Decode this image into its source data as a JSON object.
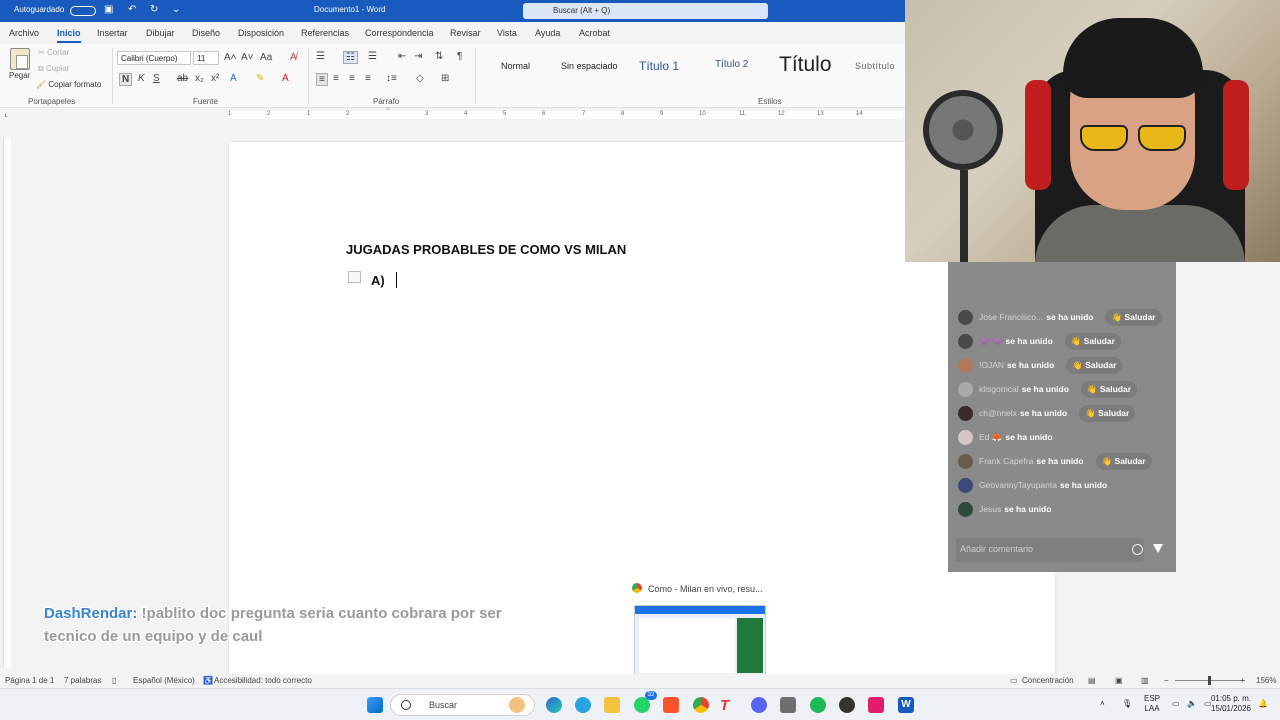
{
  "titlebar": {
    "autosave": "Autoguardado",
    "doc_title": "Documento1 - Word",
    "search_placeholder": "Buscar (Alt + Q)"
  },
  "ribbon_tabs": [
    "Archivo",
    "Inicio",
    "Insertar",
    "Dibujar",
    "Diseño",
    "Disposición",
    "Referencias",
    "Correspondencia",
    "Revisar",
    "Vista",
    "Ayuda",
    "Acrobat"
  ],
  "clipboard": {
    "paste": "Pegar",
    "cut": "Cortar",
    "copy": "Copiar",
    "format_painter": "Copiar formato",
    "group": "Portapapeles"
  },
  "font": {
    "name": "Calibri (Cuerpo)",
    "size": "11",
    "group": "Fuente"
  },
  "paragraph": {
    "group": "Párrafo"
  },
  "styles": {
    "group": "Estilos",
    "items": [
      "Normal",
      "Sin espaciado",
      "Título 1",
      "Título 2",
      "Título",
      "Subtítulo"
    ]
  },
  "ruler_ticks": [
    "1",
    "2",
    "1",
    "2",
    "3",
    "4",
    "5",
    "6",
    "7",
    "8",
    "9",
    "10",
    "11",
    "12",
    "13",
    "14"
  ],
  "document": {
    "heading": "JUGADAS PROBABLES DE COMO VS MILAN",
    "item": "A)"
  },
  "chat": {
    "join_text": "se ha unido",
    "greet_label": "Saludar",
    "rows": [
      {
        "user": "Jose Francisco...",
        "greet": true
      },
      {
        "user": "👾 👾",
        "greet": true
      },
      {
        "user": "!OJAN",
        "greet": true
      },
      {
        "user": "klisgomcal",
        "greet": true
      },
      {
        "user": "ch@nnelx",
        "greet": true
      },
      {
        "user": "Ed 🦊",
        "greet": false
      },
      {
        "user": "Frank Capefra",
        "greet": true
      },
      {
        "user": "GeovannyTayupanta",
        "greet": false
      },
      {
        "user": "Jesus",
        "greet": false
      }
    ],
    "comment_placeholder": "Añadir comentario"
  },
  "preview": {
    "title": "Como - Milan en vivo, resu..."
  },
  "overlay": {
    "user": "DashRendar:",
    "message": "!pablito doc pregunta seria cuanto cobrara por ser tecnico de un equipo y de caul"
  },
  "statusbar": {
    "page": "Página 1 de 1",
    "words": "7 palabras",
    "language": "Español (México)",
    "accessibility": "Accesibilidad: todo correcto",
    "focus": "Concentración",
    "zoom": "156%"
  },
  "taskbar": {
    "search": "Buscar",
    "whatsapp_badge": "32",
    "lang_top": "ESP",
    "lang_bottom": "LAA",
    "time": "01:05 p. m.",
    "date": "15/01/2026"
  }
}
